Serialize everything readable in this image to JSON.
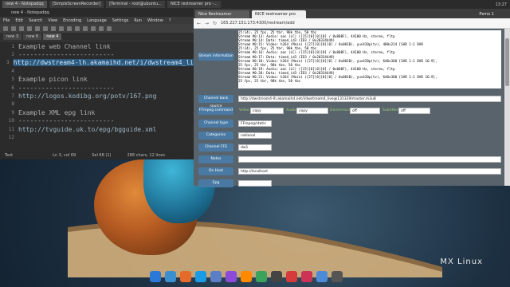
{
  "topbar": {
    "tasks": [
      "new 4 - Notepadqq",
      "[SimpleScreenRecorder]",
      "[Terminal - root@ubuntu...",
      "NICE restreamer pro -..."
    ],
    "clock": "Pemo 1",
    "time": "13:27"
  },
  "editor": {
    "title": "new 4 - Notepadqq",
    "menu": [
      "File",
      "Edit",
      "Search",
      "View",
      "Encoding",
      "Language",
      "Settings",
      "Run",
      "Window",
      "?"
    ],
    "tabs": [
      "new 3",
      "new 6",
      "new 4"
    ],
    "lines": [
      {
        "n": "1",
        "t": "Example web Channel link"
      },
      {
        "n": "2",
        "t": "-------------------------"
      },
      {
        "n": "3",
        "t": "http://dwstream4-lh.akamaihd.net/i/dwstream4_li"
      },
      {
        "n": "4",
        "t": ""
      },
      {
        "n": "5",
        "t": "Example picon link"
      },
      {
        "n": "6",
        "t": "-------------------------"
      },
      {
        "n": "7",
        "t": "http://logos.kodibg.org/potv/167.png"
      },
      {
        "n": "8",
        "t": ""
      },
      {
        "n": "9",
        "t": "Example XML epg link"
      },
      {
        "n": "10",
        "t": "-------------------------"
      },
      {
        "n": "11",
        "t": "http://tvguide.uk.to/epg/bgguide.xml"
      },
      {
        "n": "12",
        "t": ""
      }
    ],
    "status": {
      "mode": "Text",
      "pos": "Ln 3, col 69",
      "sel": "Sel 68 (1)",
      "chars": "288 chars, 12 lines"
    }
  },
  "browser": {
    "tabs": [
      "Nice Restreamer",
      "NICE restreamer pro"
    ],
    "user": "Pemo 1",
    "url": "165.227.151.173:4300/restream/add",
    "labels": {
      "stream_info": "Stream information",
      "channel_src": "Channel back source",
      "ffmpeg": "FFmpeg command",
      "type": "Channel type",
      "categories": "Categories",
      "ffs": "Channel FFS",
      "notes": "Notes",
      "on_host": "On Host",
      "epg": "Epg"
    },
    "stream_info_lines": [
      "25:14), 25 fps, 25 tbr, 90k tbn, 50 tbc",
      "    Stream #0:13: Audio: aac (LC) ([15][0][0][0] / 0x000F), 44100 Hz, stereo, fltp",
      "    Stream #0:14: Data: timed_id3 (ID3  / 0x20334449)",
      "    Stream #0:15: Video: h264 (Main) ([27][0][0][0] / 0x001B), yuv420p(tv), 480x224 [SAR 1:1 DAR",
      "25:14), 25 fps, 25 tbr, 90k tbn, 50 tbc",
      "    Stream #0:16: Audio: aac (LC) ([15][0][0][0] / 0x000F), 44100 Hz, stereo, fltp",
      "    Stream #0:17: Data: timed_id3 (ID3  / 0x20334449)",
      "    Stream #0:18: Video: h264 (Main) ([27][0][0][0] / 0x001B), yuv420p(tv), 640x360 [SAR 1:1 DAR 16:9],",
      "25 fps, 25 tbr, 90k tbn, 50 tbc",
      "    Stream #0:19: Audio: aac (LC) ([15][0][0][0] / 0x000F), 44100 Hz, stereo, fltp",
      "    Stream #0:20: Data: timed_id3 (ID3  / 0x20334449)",
      "    Stream #0:21: Video: h264 (Main) ([27][0][0][0] / 0x001B), yuv420p(tv), 640x360 [SAR 1:1 DAR 16:9],",
      "25 fps, 25 tbr, 90k tbn, 50 tbc"
    ],
    "channel_src_value": "http://dwstream4-lh.akamaihd.net/i/dwstream4_live@131329/master.m3u8",
    "ffmpeg": {
      "video_lbl": "Video",
      "video": "copy",
      "audio_lbl": "Audio",
      "audio": "copy",
      "deinterlace_lbl": "Deinterlace",
      "deinterlace": "off",
      "subtitles_lbl": "Subtitles",
      "subtitles": "off"
    },
    "type_value": "FFmpeg/static",
    "categories_value": "national",
    "ffs_value": "dw1",
    "on_host_value": "http://localhost"
  },
  "desktop": {
    "logo": "MX Linux",
    "dock_colors": [
      "#2b78d8",
      "#3a8fd0",
      "#e56b2a",
      "#1a9be6",
      "#5b7fc7",
      "#8b4bd8",
      "#ff8a00",
      "#3aa35b",
      "#444444",
      "#d63a3a",
      "#cc3355",
      "#4d8bd9",
      "#555555"
    ]
  }
}
